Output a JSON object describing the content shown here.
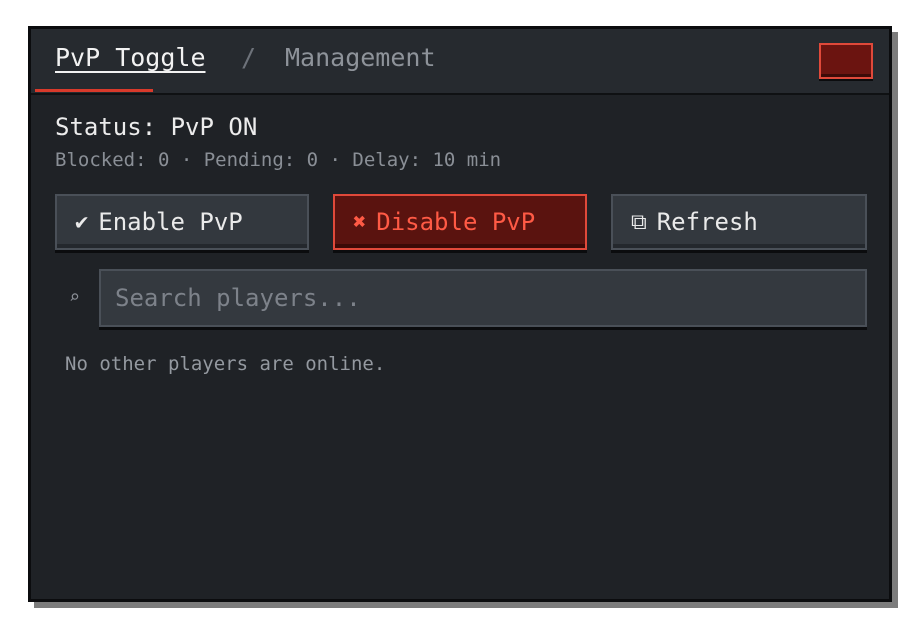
{
  "titlebar": {
    "active_tab": "PvP Toggle",
    "separator": "/",
    "inactive_tab": "Management"
  },
  "status": {
    "text": "Status: PvP ON",
    "meta": "Blocked: 0 · Pending: 0 · Delay: 10 min"
  },
  "actions": {
    "enable": {
      "icon": "✔",
      "label": "Enable PvP"
    },
    "disable": {
      "icon": "✖",
      "label": "Disable PvP"
    },
    "refresh": {
      "icon": "⧉",
      "label": "Refresh"
    }
  },
  "search": {
    "icon": "⌕",
    "placeholder": "Search players...",
    "value": ""
  },
  "players": {
    "empty_message": "No other players are online."
  },
  "colors": {
    "accent": "#d83a2b",
    "danger_text": "#ff5a45",
    "panel_bg": "#1f2226"
  }
}
